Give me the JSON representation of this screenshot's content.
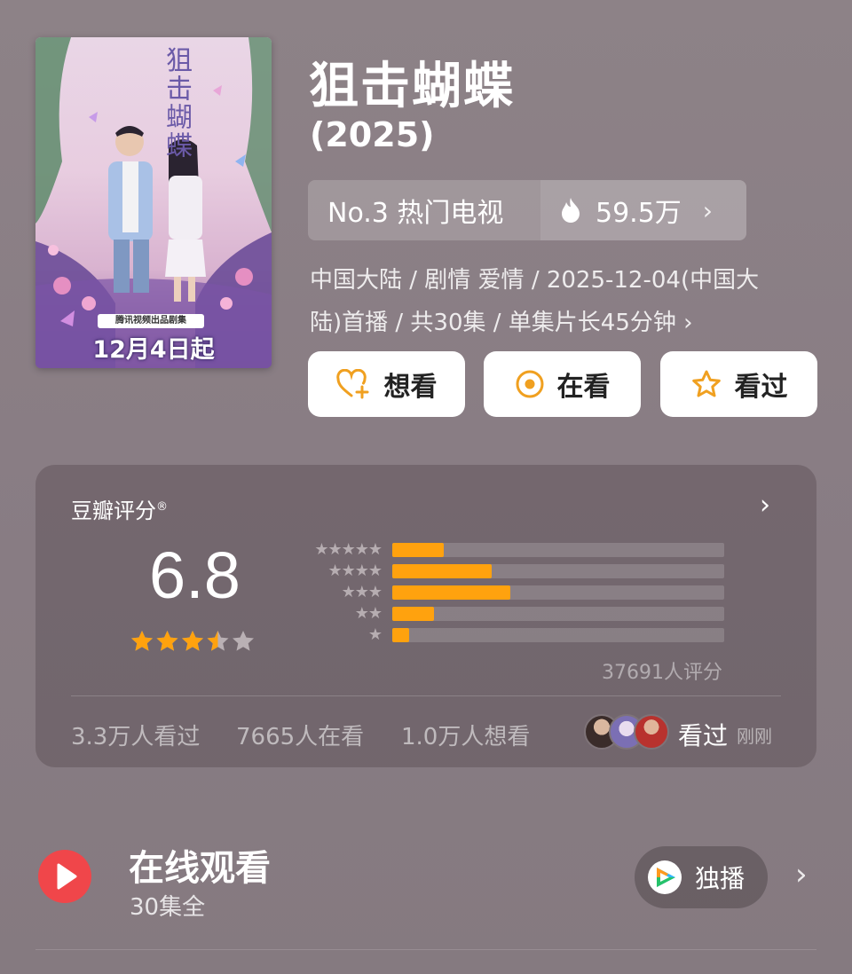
{
  "poster": {
    "title_art": "狙击蝴蝶",
    "studio_line": "腾讯视频出品剧集",
    "release_line": "12月4日起"
  },
  "show": {
    "title": "狙击蝴蝶",
    "year": "(2025)",
    "rank_label": "No.3 热门电视",
    "heat_value": "59.5万",
    "meta_line1": "中国大陆 / 剧情 爱情 / 2025-12-04(中国大",
    "meta_line2": "陆)首播 / 共30集 / 单集片长45分钟 ›"
  },
  "actions": {
    "want_label": "想看",
    "watching_label": "在看",
    "watched_label": "看过"
  },
  "rating": {
    "header": "豆瓣评分",
    "registered": "®",
    "score": "6.8",
    "star_value": 3.5,
    "distribution": [
      {
        "stars": "★★★★★",
        "fraction": 0.155
      },
      {
        "stars": "★★★★",
        "fraction": 0.3
      },
      {
        "stars": "★★★",
        "fraction": 0.355
      },
      {
        "stars": "★★",
        "fraction": 0.125
      },
      {
        "stars": "★",
        "fraction": 0.05
      }
    ],
    "votes": "37691人评分",
    "watched_count": "3.3万人看过",
    "watching_count": "7665人在看",
    "want_count": "1.0万人想看",
    "friend_action": "看过",
    "friend_time": "刚刚"
  },
  "online": {
    "title": "在线观看",
    "episodes": "30集全",
    "exclusive_label": "独播"
  },
  "colors": {
    "accent_orange": "#ffa20e",
    "play_red": "#f0464a",
    "action_icon": "#f0a020"
  }
}
